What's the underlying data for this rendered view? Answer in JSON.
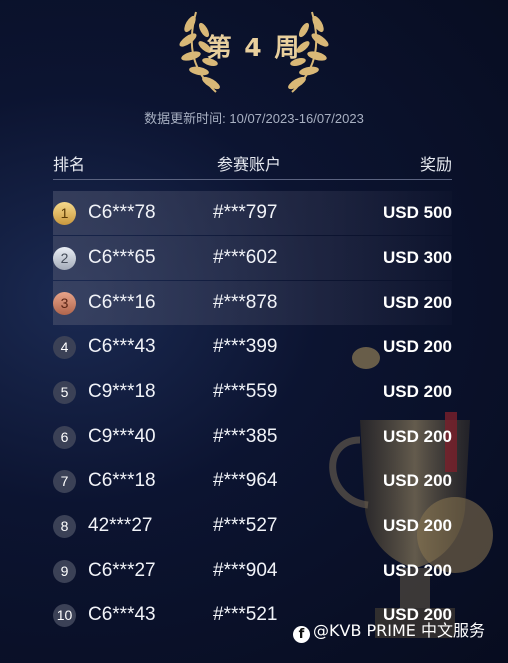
{
  "header": {
    "week_title": "第 4 周",
    "update_label": "数据更新时间: 10/07/2023-16/07/2023"
  },
  "table": {
    "columns": [
      "排名",
      "参赛账户",
      "奖励"
    ],
    "rows": [
      {
        "rank": "1",
        "account": "C6***78",
        "member": "#***797",
        "prize": "USD 500"
      },
      {
        "rank": "2",
        "account": "C6***65",
        "member": "#***602",
        "prize": "USD 300"
      },
      {
        "rank": "3",
        "account": "C6***16",
        "member": "#***878",
        "prize": "USD 200"
      },
      {
        "rank": "4",
        "account": "C6***43",
        "member": "#***399",
        "prize": "USD 200"
      },
      {
        "rank": "5",
        "account": "C9***18",
        "member": "#***559",
        "prize": "USD 200"
      },
      {
        "rank": "6",
        "account": "C9***40",
        "member": "#***385",
        "prize": "USD 200"
      },
      {
        "rank": "7",
        "account": "C6***18",
        "member": "#***964",
        "prize": "USD 200"
      },
      {
        "rank": "8",
        "account": "42***27",
        "member": "#***527",
        "prize": "USD 200"
      },
      {
        "rank": "9",
        "account": "C6***27",
        "member": "#***904",
        "prize": "USD 200"
      },
      {
        "rank": "10",
        "account": "C6***43",
        "member": "#***521",
        "prize": "USD 200"
      }
    ]
  },
  "watermark": {
    "text": "@KVB PRIME 中文服务",
    "icon": "facebook-icon"
  },
  "colors": {
    "gold": "#e8cf9d",
    "background": "#0c1431",
    "silver": "#c9cfd8",
    "bronze": "#c97a5f"
  }
}
